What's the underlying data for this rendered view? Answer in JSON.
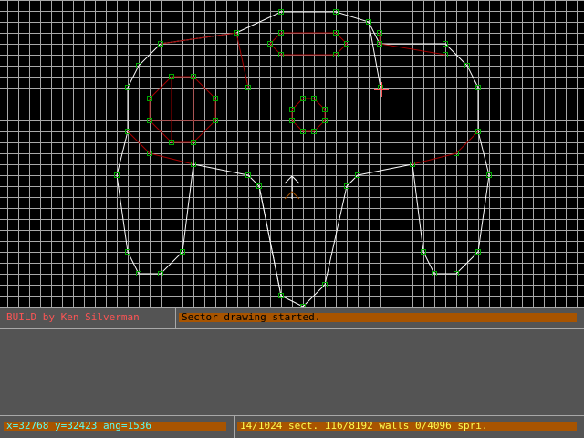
{
  "app": {
    "title": "BUILD by Ken Silverman"
  },
  "status": {
    "message": "Sector drawing started.",
    "coords": "x=32768 y=32423 ang=1536",
    "counts": "14/1024 sect. 116/8192 walls 0/4096 spri."
  },
  "colors": {
    "background": "#000000",
    "grid": "#a8a8a8",
    "white_wall": "#fcfcfc",
    "red_wall": "#a80000",
    "vertex": "#00a800",
    "cursor": "#fc5454",
    "panel": "#545454",
    "bar": "#a85400"
  },
  "icons": {
    "cursor": "crosshair-icon",
    "player": "player-arrow-icon"
  }
}
